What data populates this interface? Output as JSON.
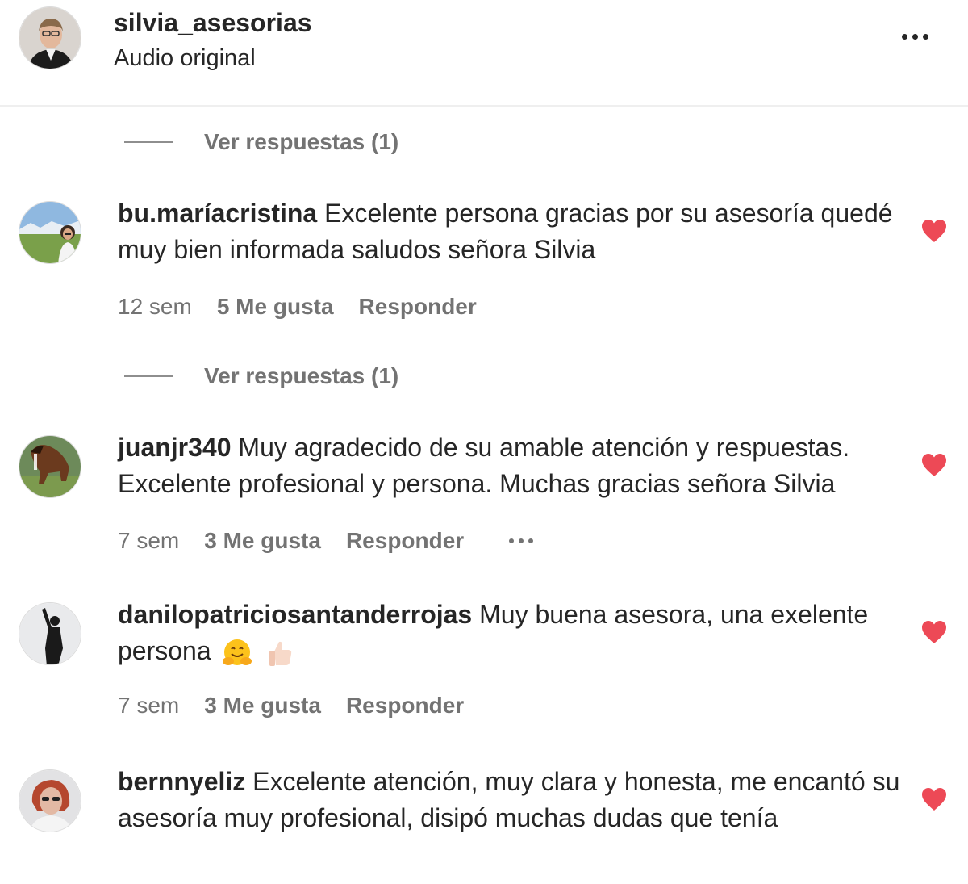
{
  "header": {
    "username": "silvia_asesorias",
    "subtitle": "Audio original",
    "menu_icon": "more-horizontal-icon"
  },
  "view_replies": [
    "Ver respuestas (1)",
    "Ver respuestas (1)"
  ],
  "comments": [
    {
      "author": "bu.maríacristina",
      "text": " Excelente persona gracias por su asesoría quedé muy bien informada saludos señora Silvia",
      "time": "12 sem",
      "likes": "5 Me gusta",
      "reply": "Responder",
      "liked": true
    },
    {
      "author": "juanjr340",
      "text": " Muy agradecido de su amable atención y respuestas. Excelente profesional y persona. Muchas gracias señora Silvia",
      "time": "7 sem",
      "likes": "3 Me gusta",
      "reply": "Responder",
      "liked": true
    },
    {
      "author": "danilopatriciosantanderrojas",
      "text": " Muy buena asesora, una exelente persona",
      "emojis": [
        "hugging-face-emoji",
        "thumbs-up-emoji"
      ],
      "time": "7 sem",
      "likes": "3 Me gusta",
      "reply": "Responder",
      "liked": true
    },
    {
      "author": "bernnyeliz",
      "text": " Excelente atención, muy clara y honesta, me encantó su asesoría muy profesional, disipó muchas dudas que tenía",
      "liked": true
    }
  ],
  "colors": {
    "heart": "#ed4956",
    "text": "#262626",
    "secondary": "#737373"
  }
}
